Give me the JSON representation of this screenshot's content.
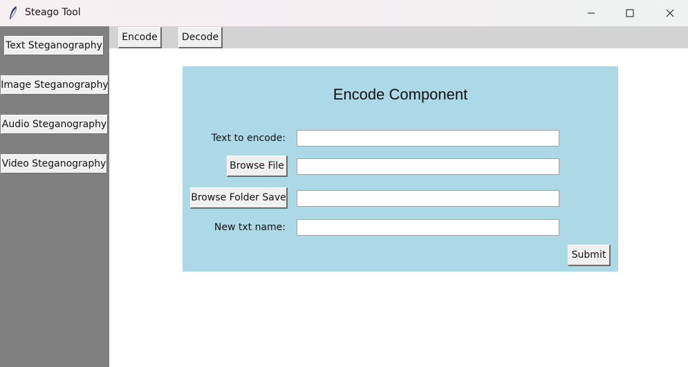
{
  "window": {
    "title": "Steago Tool",
    "icon": "feather-icon",
    "controls": [
      "minimize-icon",
      "maximize-icon",
      "close-icon"
    ]
  },
  "sidebar": {
    "background": "#808080",
    "items": [
      {
        "label": "Text Steganography"
      },
      {
        "label": "Image Steganography"
      },
      {
        "label": "Audio Steganography"
      },
      {
        "label": "Video Steganography"
      }
    ]
  },
  "toolbar": {
    "background": "#d3d3d3",
    "tabs": [
      {
        "label": "Encode"
      },
      {
        "label": "Decode"
      }
    ]
  },
  "encode_panel": {
    "background": "#add8e6",
    "title": "Encode Component",
    "text_label": "Text to encode:",
    "text_value": "",
    "browse_file_label": "Browse File",
    "file_value": "",
    "browse_folder_label": "Browse Folder Save",
    "folder_value": "",
    "new_name_label": "New txt name:",
    "new_name_value": "",
    "submit_label": "Submit"
  }
}
